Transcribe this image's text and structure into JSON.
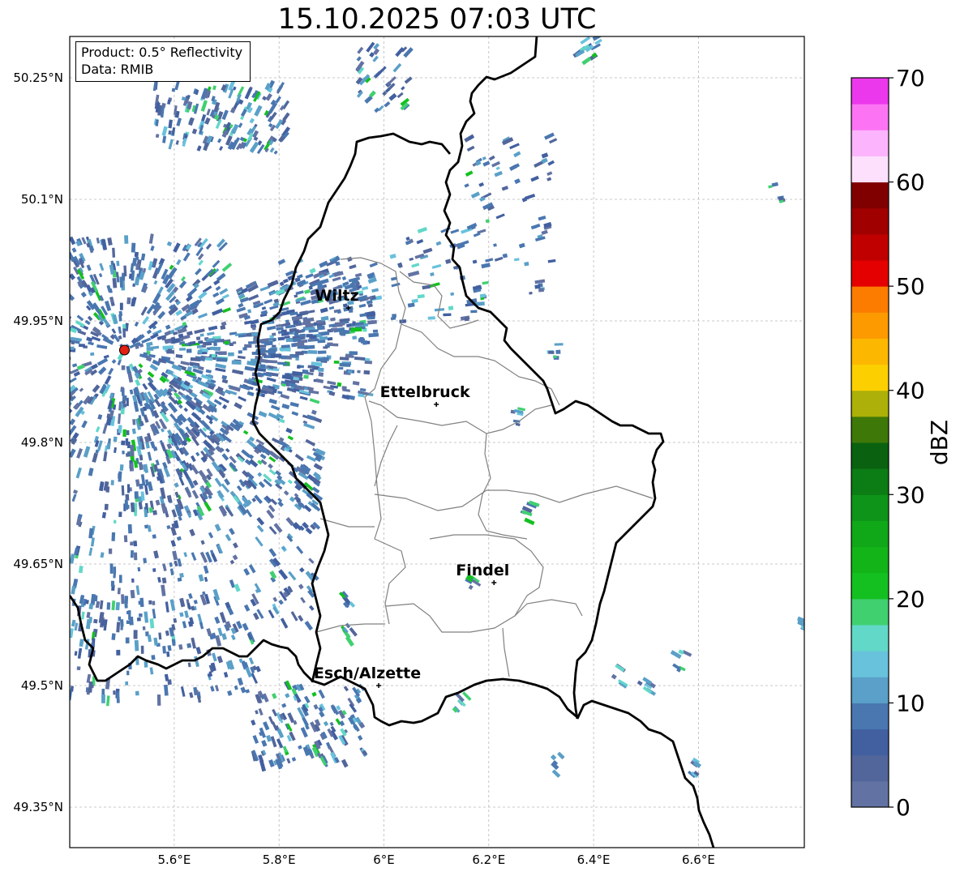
{
  "title": "15.10.2025 07:03 UTC",
  "info": {
    "product": "Product: 0.5° Reflectivity",
    "data": "Data: RMIB"
  },
  "map": {
    "lon_range": [
      5.4,
      6.8
    ],
    "lat_range": [
      49.3,
      50.3
    ],
    "lon_ticks": [
      {
        "value": 5.6,
        "label": "5.6°E"
      },
      {
        "value": 5.8,
        "label": "5.8°E"
      },
      {
        "value": 6.0,
        "label": "6°E"
      },
      {
        "value": 6.2,
        "label": "6.2°E"
      },
      {
        "value": 6.4,
        "label": "6.4°E"
      },
      {
        "value": 6.6,
        "label": "6.6°E"
      }
    ],
    "lat_ticks": [
      {
        "value": 50.25,
        "label": "50.25°N"
      },
      {
        "value": 50.1,
        "label": "50.1°N"
      },
      {
        "value": 49.95,
        "label": "49.95°N"
      },
      {
        "value": 49.8,
        "label": "49.8°N"
      },
      {
        "value": 49.65,
        "label": "49.65°N"
      },
      {
        "value": 49.5,
        "label": "49.5°N"
      },
      {
        "value": 49.35,
        "label": "49.35°N"
      }
    ],
    "radar_site": {
      "lon": 5.505,
      "lat": 49.914
    },
    "cities": [
      {
        "name": "Wiltz",
        "lon": 5.932,
        "lat": 49.966
      },
      {
        "name": "Ettelbruck",
        "lon": 6.1,
        "lat": 49.847
      },
      {
        "name": "Findel",
        "lon": 6.21,
        "lat": 49.627
      },
      {
        "name": "Esch/Alzette",
        "lon": 5.99,
        "lat": 49.5
      }
    ]
  },
  "colorbar": {
    "label": "dBZ",
    "min": 0,
    "max": 70,
    "ticks": [
      {
        "value": 0,
        "label": "0"
      },
      {
        "value": 10,
        "label": "10"
      },
      {
        "value": 20,
        "label": "20"
      },
      {
        "value": 30,
        "label": "30"
      },
      {
        "value": 40,
        "label": "40"
      },
      {
        "value": 50,
        "label": "50"
      },
      {
        "value": 60,
        "label": "60"
      },
      {
        "value": 70,
        "label": "70"
      }
    ],
    "colors": [
      "#6273a3",
      "#52669b",
      "#4260a0",
      "#4a77b0",
      "#5aa0c8",
      "#68c2dc",
      "#62d8c8",
      "#40d070",
      "#14c020",
      "#12b418",
      "#10a818",
      "#0e9418",
      "#0c7c14",
      "#0a6210",
      "#3e7808",
      "#adb008",
      "#fcd000",
      "#fcb800",
      "#fc9a00",
      "#fc7c00",
      "#e40000",
      "#c00000",
      "#a00000",
      "#800000",
      "#fce0fc",
      "#fcb4fc",
      "#fc74f4",
      "#ec38ec"
    ]
  }
}
